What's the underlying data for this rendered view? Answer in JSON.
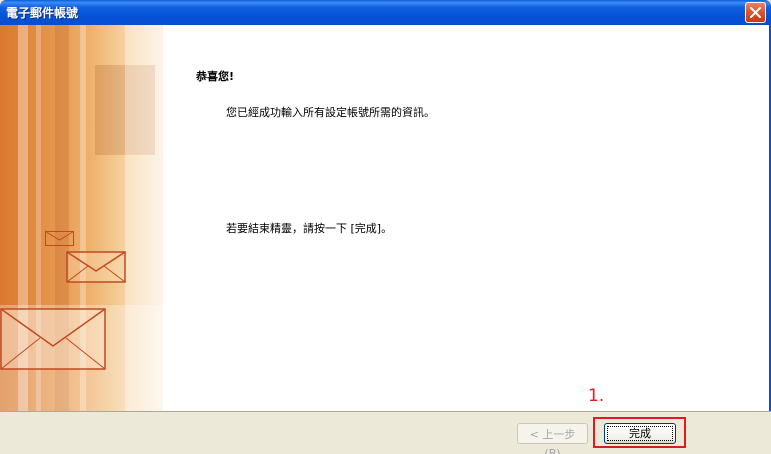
{
  "window": {
    "title": "電子郵件帳號"
  },
  "content": {
    "heading": "恭喜您!",
    "line1": "您已經成功輸入所有設定帳號所需的資訊。",
    "line2": "若要結束精靈，請按一下 [完成]。"
  },
  "buttons": {
    "back": "< 上一步(B)",
    "finish": "完成"
  },
  "annotation": {
    "label": "1.",
    "color": "#e11b1b"
  },
  "colors": {
    "titlebar": "#0551d6",
    "close": "#d9532e",
    "dialog": "#ece9d8",
    "art": "#e5934a"
  }
}
